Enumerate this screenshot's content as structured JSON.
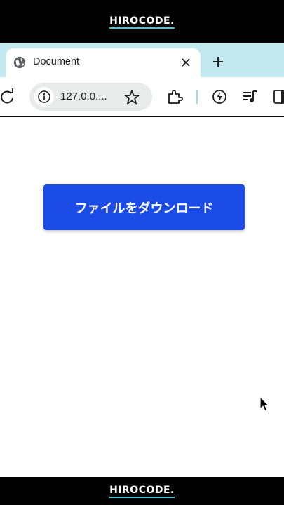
{
  "brand": {
    "top_text": "HIROCODE.",
    "bottom_text": "HIROCODE."
  },
  "tab": {
    "title": "Document",
    "favicon": "globe-icon",
    "close": "close-icon"
  },
  "tabstrip": {
    "new_tab": "plus-icon"
  },
  "toolbar": {
    "reload": "reload-icon",
    "url": "127.0.0....",
    "info": "info-icon",
    "bookmark": "star-icon",
    "extensions": "puzzle-icon",
    "performance": "lightning-icon",
    "media": "playlist-icon",
    "sidepanel": "side-panel-icon"
  },
  "page": {
    "download_label": "ファイルをダウンロード"
  },
  "colors": {
    "tabstrip": "#c3e9f0",
    "button": "#1c4ce8",
    "brand_underline": "#4fc3d9"
  }
}
